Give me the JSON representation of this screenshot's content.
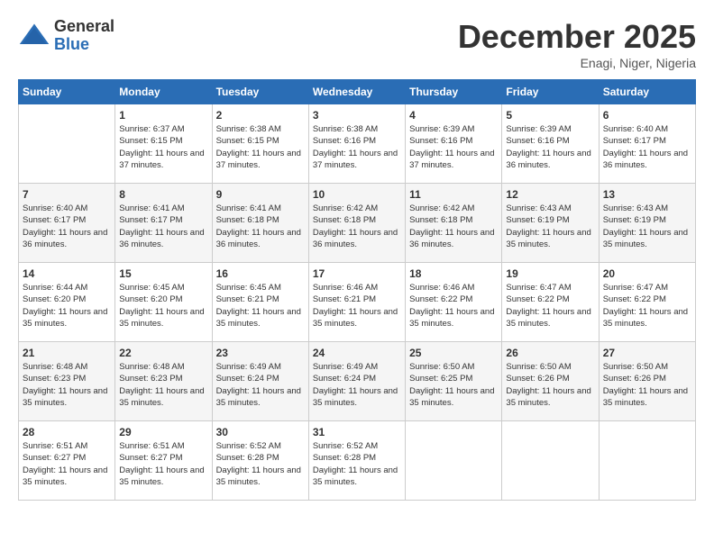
{
  "header": {
    "logo_general": "General",
    "logo_blue": "Blue",
    "month_title": "December 2025",
    "location": "Enagi, Niger, Nigeria"
  },
  "days_of_week": [
    "Sunday",
    "Monday",
    "Tuesday",
    "Wednesday",
    "Thursday",
    "Friday",
    "Saturday"
  ],
  "weeks": [
    [
      {
        "day": "",
        "info": ""
      },
      {
        "day": "1",
        "info": "Sunrise: 6:37 AM\nSunset: 6:15 PM\nDaylight: 11 hours and 37 minutes."
      },
      {
        "day": "2",
        "info": "Sunrise: 6:38 AM\nSunset: 6:15 PM\nDaylight: 11 hours and 37 minutes."
      },
      {
        "day": "3",
        "info": "Sunrise: 6:38 AM\nSunset: 6:16 PM\nDaylight: 11 hours and 37 minutes."
      },
      {
        "day": "4",
        "info": "Sunrise: 6:39 AM\nSunset: 6:16 PM\nDaylight: 11 hours and 37 minutes."
      },
      {
        "day": "5",
        "info": "Sunrise: 6:39 AM\nSunset: 6:16 PM\nDaylight: 11 hours and 36 minutes."
      },
      {
        "day": "6",
        "info": "Sunrise: 6:40 AM\nSunset: 6:17 PM\nDaylight: 11 hours and 36 minutes."
      }
    ],
    [
      {
        "day": "7",
        "info": "Sunrise: 6:40 AM\nSunset: 6:17 PM\nDaylight: 11 hours and 36 minutes."
      },
      {
        "day": "8",
        "info": "Sunrise: 6:41 AM\nSunset: 6:17 PM\nDaylight: 11 hours and 36 minutes."
      },
      {
        "day": "9",
        "info": "Sunrise: 6:41 AM\nSunset: 6:18 PM\nDaylight: 11 hours and 36 minutes."
      },
      {
        "day": "10",
        "info": "Sunrise: 6:42 AM\nSunset: 6:18 PM\nDaylight: 11 hours and 36 minutes."
      },
      {
        "day": "11",
        "info": "Sunrise: 6:42 AM\nSunset: 6:18 PM\nDaylight: 11 hours and 36 minutes."
      },
      {
        "day": "12",
        "info": "Sunrise: 6:43 AM\nSunset: 6:19 PM\nDaylight: 11 hours and 35 minutes."
      },
      {
        "day": "13",
        "info": "Sunrise: 6:43 AM\nSunset: 6:19 PM\nDaylight: 11 hours and 35 minutes."
      }
    ],
    [
      {
        "day": "14",
        "info": "Sunrise: 6:44 AM\nSunset: 6:20 PM\nDaylight: 11 hours and 35 minutes."
      },
      {
        "day": "15",
        "info": "Sunrise: 6:45 AM\nSunset: 6:20 PM\nDaylight: 11 hours and 35 minutes."
      },
      {
        "day": "16",
        "info": "Sunrise: 6:45 AM\nSunset: 6:21 PM\nDaylight: 11 hours and 35 minutes."
      },
      {
        "day": "17",
        "info": "Sunrise: 6:46 AM\nSunset: 6:21 PM\nDaylight: 11 hours and 35 minutes."
      },
      {
        "day": "18",
        "info": "Sunrise: 6:46 AM\nSunset: 6:22 PM\nDaylight: 11 hours and 35 minutes."
      },
      {
        "day": "19",
        "info": "Sunrise: 6:47 AM\nSunset: 6:22 PM\nDaylight: 11 hours and 35 minutes."
      },
      {
        "day": "20",
        "info": "Sunrise: 6:47 AM\nSunset: 6:22 PM\nDaylight: 11 hours and 35 minutes."
      }
    ],
    [
      {
        "day": "21",
        "info": "Sunrise: 6:48 AM\nSunset: 6:23 PM\nDaylight: 11 hours and 35 minutes."
      },
      {
        "day": "22",
        "info": "Sunrise: 6:48 AM\nSunset: 6:23 PM\nDaylight: 11 hours and 35 minutes."
      },
      {
        "day": "23",
        "info": "Sunrise: 6:49 AM\nSunset: 6:24 PM\nDaylight: 11 hours and 35 minutes."
      },
      {
        "day": "24",
        "info": "Sunrise: 6:49 AM\nSunset: 6:24 PM\nDaylight: 11 hours and 35 minutes."
      },
      {
        "day": "25",
        "info": "Sunrise: 6:50 AM\nSunset: 6:25 PM\nDaylight: 11 hours and 35 minutes."
      },
      {
        "day": "26",
        "info": "Sunrise: 6:50 AM\nSunset: 6:26 PM\nDaylight: 11 hours and 35 minutes."
      },
      {
        "day": "27",
        "info": "Sunrise: 6:50 AM\nSunset: 6:26 PM\nDaylight: 11 hours and 35 minutes."
      }
    ],
    [
      {
        "day": "28",
        "info": "Sunrise: 6:51 AM\nSunset: 6:27 PM\nDaylight: 11 hours and 35 minutes."
      },
      {
        "day": "29",
        "info": "Sunrise: 6:51 AM\nSunset: 6:27 PM\nDaylight: 11 hours and 35 minutes."
      },
      {
        "day": "30",
        "info": "Sunrise: 6:52 AM\nSunset: 6:28 PM\nDaylight: 11 hours and 35 minutes."
      },
      {
        "day": "31",
        "info": "Sunrise: 6:52 AM\nSunset: 6:28 PM\nDaylight: 11 hours and 35 minutes."
      },
      {
        "day": "",
        "info": ""
      },
      {
        "day": "",
        "info": ""
      },
      {
        "day": "",
        "info": ""
      }
    ]
  ]
}
